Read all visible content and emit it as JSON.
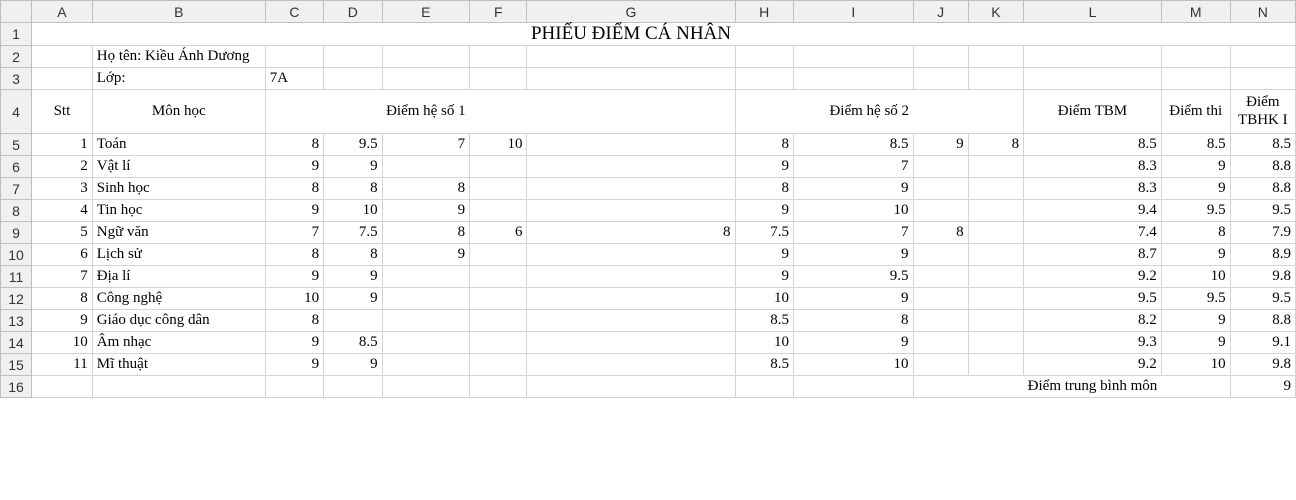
{
  "cols": [
    "",
    "A",
    "B",
    "C",
    "D",
    "E",
    "F",
    "G",
    "H",
    "I",
    "J",
    "K",
    "L",
    "M",
    "N"
  ],
  "title": "PHIẾU ĐIỂM CÁ NHÂN",
  "name_label": "Họ tên: Kiều Ánh Dương",
  "class_label": "Lớp:",
  "class_value": "7A",
  "hdr": {
    "stt": "Stt",
    "mon": "Môn học",
    "h1": "Điểm hệ số 1",
    "h2": "Điểm hệ số 2",
    "tbm": "Điểm TBM",
    "thi": "Điểm thi",
    "tbhk": "Điểm TBHK I"
  },
  "footer_label": "Điểm trung bình môn",
  "footer_value": "9",
  "subjects": [
    {
      "n": "1",
      "name": "Toán",
      "h1": [
        "8",
        "9.5",
        "7",
        "10",
        ""
      ],
      "h2": [
        "8",
        "8.5",
        "9",
        "8"
      ],
      "tbm": "8.5",
      "thi": "8.5",
      "tbhk": "8.5"
    },
    {
      "n": "2",
      "name": "Vật lí",
      "h1": [
        "9",
        "9",
        "",
        "",
        ""
      ],
      "h2": [
        "9",
        "7",
        "",
        ""
      ],
      "tbm": "8.3",
      "thi": "9",
      "tbhk": "8.8"
    },
    {
      "n": "3",
      "name": "Sinh học",
      "h1": [
        "8",
        "8",
        "8",
        "",
        ""
      ],
      "h2": [
        "8",
        "9",
        "",
        ""
      ],
      "tbm": "8.3",
      "thi": "9",
      "tbhk": "8.8"
    },
    {
      "n": "4",
      "name": "Tin học",
      "h1": [
        "9",
        "10",
        "9",
        "",
        ""
      ],
      "h2": [
        "9",
        "10",
        "",
        ""
      ],
      "tbm": "9.4",
      "thi": "9.5",
      "tbhk": "9.5"
    },
    {
      "n": "5",
      "name": "Ngữ văn",
      "h1": [
        "7",
        "7.5",
        "8",
        "6",
        "8"
      ],
      "h2": [
        "7.5",
        "7",
        "8",
        ""
      ],
      "tbm": "7.4",
      "thi": "8",
      "tbhk": "7.9"
    },
    {
      "n": "6",
      "name": "Lịch sử",
      "h1": [
        "8",
        "8",
        "9",
        "",
        ""
      ],
      "h2": [
        "9",
        "9",
        "",
        ""
      ],
      "tbm": "8.7",
      "thi": "9",
      "tbhk": "8.9"
    },
    {
      "n": "7",
      "name": "Địa lí",
      "h1": [
        "9",
        "9",
        "",
        "",
        ""
      ],
      "h2": [
        "9",
        "9.5",
        "",
        ""
      ],
      "tbm": "9.2",
      "thi": "10",
      "tbhk": "9.8"
    },
    {
      "n": "8",
      "name": "Công nghệ",
      "h1": [
        "10",
        "9",
        "",
        "",
        ""
      ],
      "h2": [
        "10",
        "9",
        "",
        ""
      ],
      "tbm": "9.5",
      "thi": "9.5",
      "tbhk": "9.5"
    },
    {
      "n": "9",
      "name": "Giáo dục công dân",
      "h1": [
        "8",
        "",
        "",
        "",
        ""
      ],
      "h2": [
        "8.5",
        "8",
        "",
        ""
      ],
      "tbm": "8.2",
      "thi": "9",
      "tbhk": "8.8"
    },
    {
      "n": "10",
      "name": "Âm nhạc",
      "h1": [
        "9",
        "8.5",
        "",
        "",
        ""
      ],
      "h2": [
        "10",
        "9",
        "",
        ""
      ],
      "tbm": "9.3",
      "thi": "9",
      "tbhk": "9.1"
    },
    {
      "n": "11",
      "name": "Mĩ thuật",
      "h1": [
        "9",
        "9",
        "",
        "",
        ""
      ],
      "h2": [
        "8.5",
        "10",
        "",
        ""
      ],
      "tbm": "9.2",
      "thi": "10",
      "tbhk": "9.8"
    }
  ]
}
